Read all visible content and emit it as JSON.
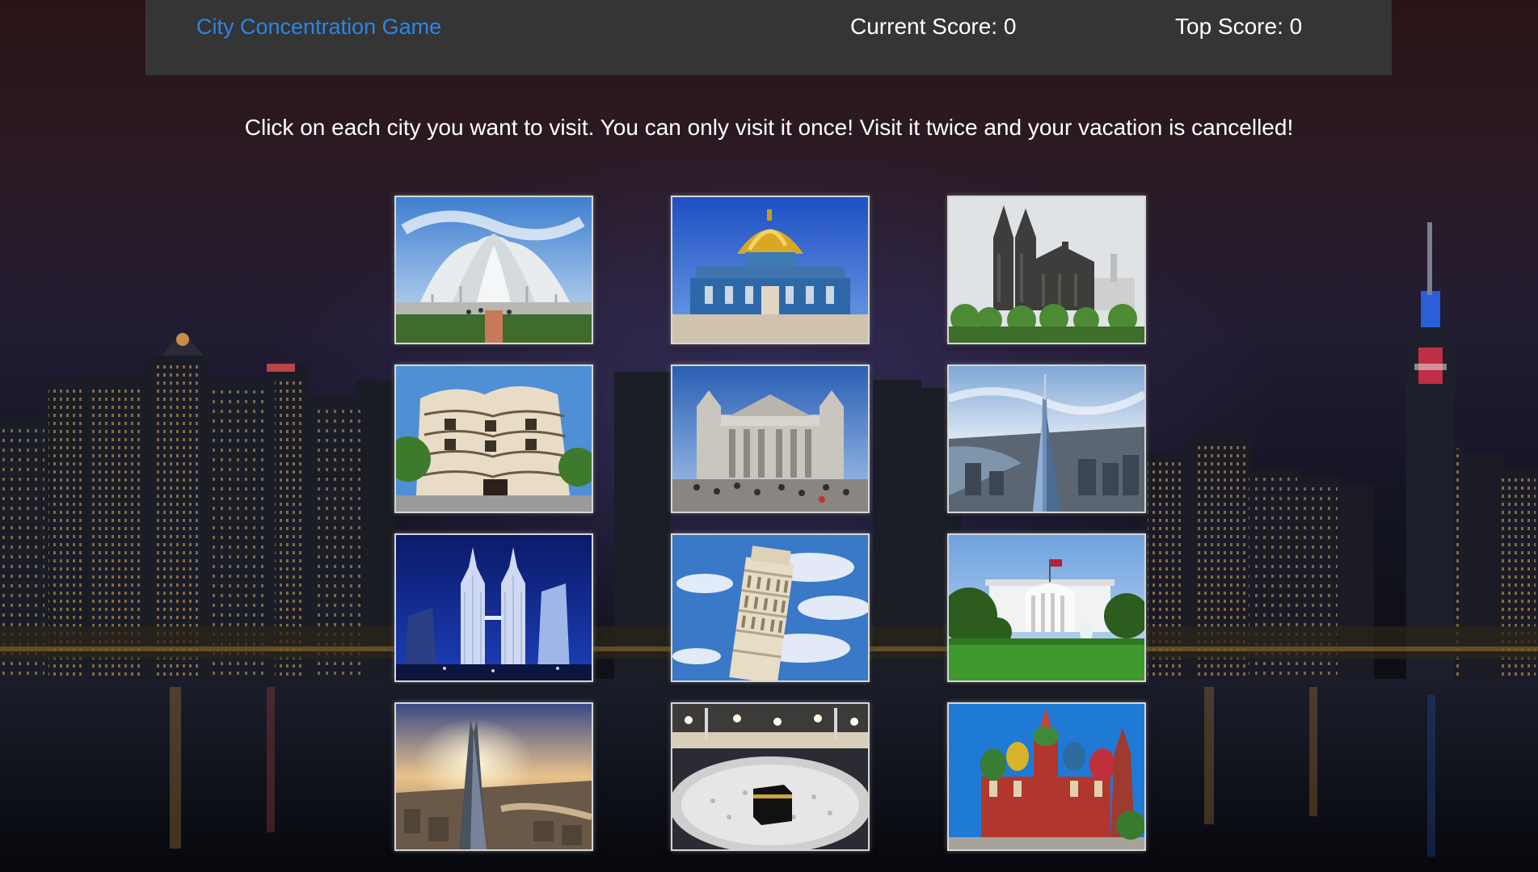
{
  "navbar": {
    "brand": "City Concentration Game",
    "current_score_label": "Current Score",
    "current_score": "0",
    "top_score_label": "Top Score",
    "top_score": "0"
  },
  "instructions": "Click on each city you want to visit. You can only visit it once! Visit it twice and your vacation is cancelled!",
  "cards": [
    {
      "landmark": "lotus-temple"
    },
    {
      "landmark": "dome-of-the-rock"
    },
    {
      "landmark": "cologne-cathedral"
    },
    {
      "landmark": "casa-mila"
    },
    {
      "landmark": "st-pauls-cathedral"
    },
    {
      "landmark": "one-world-trade-center"
    },
    {
      "landmark": "petronas-towers"
    },
    {
      "landmark": "leaning-tower-of-pisa"
    },
    {
      "landmark": "white-house"
    },
    {
      "landmark": "the-shard"
    },
    {
      "landmark": "kaaba-mecca"
    },
    {
      "landmark": "st-basils-cathedral"
    }
  ],
  "colors": {
    "brand": "#2a86e8",
    "navbar_bg": "#353535",
    "text": "#ffffff",
    "card_border": "#d6d6d6"
  }
}
